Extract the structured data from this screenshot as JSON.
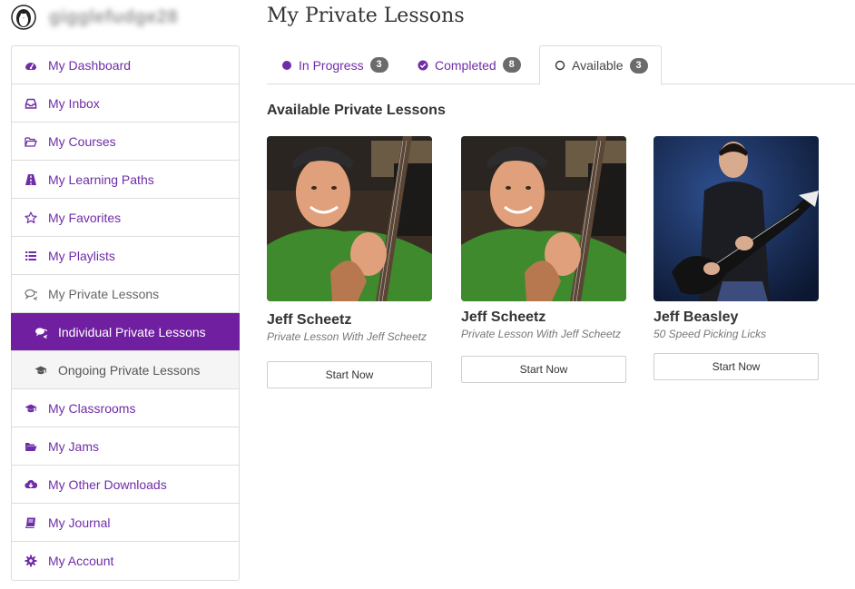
{
  "user": {
    "username": "gigglefudge28"
  },
  "colors": {
    "accent": "#6f2da8",
    "active_bg": "#6f1fa0",
    "badge": "#6b6b6b"
  },
  "sidebar": {
    "items": [
      {
        "label": "My Dashboard",
        "icon": "dashboard-icon"
      },
      {
        "label": "My Inbox",
        "icon": "inbox-icon"
      },
      {
        "label": "My Courses",
        "icon": "folder-open-icon"
      },
      {
        "label": "My Learning Paths",
        "icon": "road-icon"
      },
      {
        "label": "My Favorites",
        "icon": "star-icon"
      },
      {
        "label": "My Playlists",
        "icon": "list-icon"
      },
      {
        "label": "My Private Lessons",
        "icon": "chat-bubbles-icon"
      },
      {
        "label": "Individual Private Lessons",
        "icon": "chat-bubbles-icon"
      },
      {
        "label": "Ongoing Private Lessons",
        "icon": "graduation-cap-icon"
      },
      {
        "label": "My Classrooms",
        "icon": "graduation-cap-icon"
      },
      {
        "label": "My Jams",
        "icon": "folder-open-icon"
      },
      {
        "label": "My Other Downloads",
        "icon": "cloud-download-icon"
      },
      {
        "label": "My Journal",
        "icon": "book-icon"
      },
      {
        "label": "My Account",
        "icon": "gear-icon"
      }
    ]
  },
  "main": {
    "title": "My Private Lessons",
    "tabs": [
      {
        "label": "In Progress",
        "count": "3",
        "icon": "filled-circle-icon"
      },
      {
        "label": "Completed",
        "count": "8",
        "icon": "check-circle-icon"
      },
      {
        "label": "Available",
        "count": "3",
        "icon": "empty-circle-icon"
      }
    ],
    "section_title": "Available Private Lessons",
    "lessons": [
      {
        "instructor": "Jeff Scheetz",
        "description": "Private Lesson With Jeff Scheetz",
        "button": "Start Now"
      },
      {
        "instructor": "Jeff Scheetz",
        "description": "Private Lesson With Jeff Scheetz",
        "button": "Start Now"
      },
      {
        "instructor": "Jeff Beasley",
        "description": "50 Speed Picking Licks",
        "button": "Start Now"
      }
    ]
  }
}
